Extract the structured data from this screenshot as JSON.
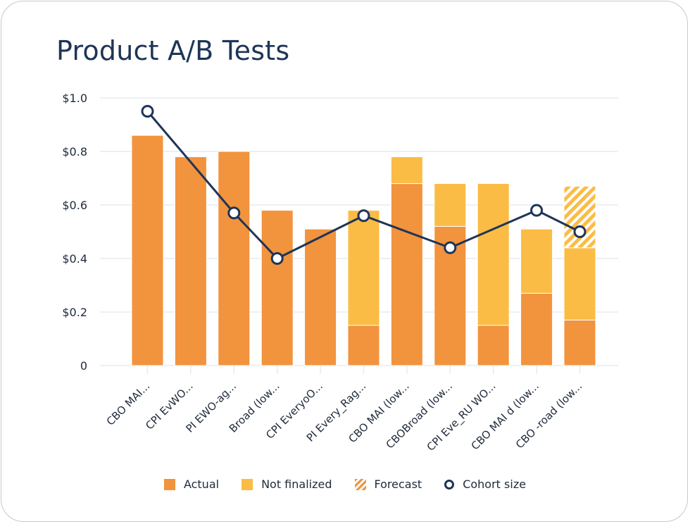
{
  "title": "Product A/B Tests",
  "colors": {
    "actual": "#f2933d",
    "not_finalized": "#fbbc45",
    "forecast": "#fbbc45",
    "cohort_line": "#1e3557",
    "grid": "#e6ebf2",
    "text": "#1f2a3a"
  },
  "legend": [
    {
      "key": "actual",
      "label": "Actual",
      "icon": "square-swatch"
    },
    {
      "key": "not_finalized",
      "label": "Not finalized",
      "icon": "square-swatch"
    },
    {
      "key": "forecast",
      "label": "Forecast",
      "icon": "striped-swatch"
    },
    {
      "key": "cohort",
      "label": "Cohort size",
      "icon": "circle-marker"
    }
  ],
  "chart_data": {
    "type": "bar",
    "stacked": true,
    "title": "Product A/B Tests",
    "xlabel": "",
    "ylabel": "",
    "ylim": [
      0,
      1.0
    ],
    "yticks": [
      {
        "value": 0,
        "label": "0"
      },
      {
        "value": 0.2,
        "label": "$0.2"
      },
      {
        "value": 0.4,
        "label": "$0.4"
      },
      {
        "value": 0.6,
        "label": "$0.6"
      },
      {
        "value": 0.8,
        "label": "$0.8"
      },
      {
        "value": 1.0,
        "label": "$1.0"
      }
    ],
    "grid": true,
    "legend_position": "bottom",
    "categories": [
      "CBO MAI...",
      "CPI EvWO...",
      "PI EWO-ag...",
      "Broad (low...",
      "CPI EveryoO...",
      "PI Every_Rag...",
      "CBO MAI (low...",
      "CBOBroad (low...",
      "CPI Eve_RU WO...",
      "CBO MAI d (low...",
      "CBO -road (low..."
    ],
    "series": [
      {
        "name": "Actual",
        "type": "bar",
        "values": [
          0.86,
          0.78,
          0.8,
          0.58,
          0.51,
          0.15,
          0.68,
          0.52,
          0.15,
          0.27,
          0.17
        ]
      },
      {
        "name": "Not finalized",
        "type": "bar",
        "values": [
          0,
          0,
          0,
          0,
          0,
          0.43,
          0.1,
          0.16,
          0.53,
          0.24,
          0.27
        ]
      },
      {
        "name": "Forecast",
        "type": "bar",
        "values": [
          0,
          0,
          0,
          0,
          0,
          0,
          0,
          0,
          0,
          0,
          0.23
        ]
      },
      {
        "name": "Cohort size",
        "type": "line",
        "values": [
          0.95,
          null,
          0.57,
          0.4,
          null,
          0.56,
          null,
          0.44,
          null,
          0.58,
          0.5
        ]
      }
    ]
  }
}
